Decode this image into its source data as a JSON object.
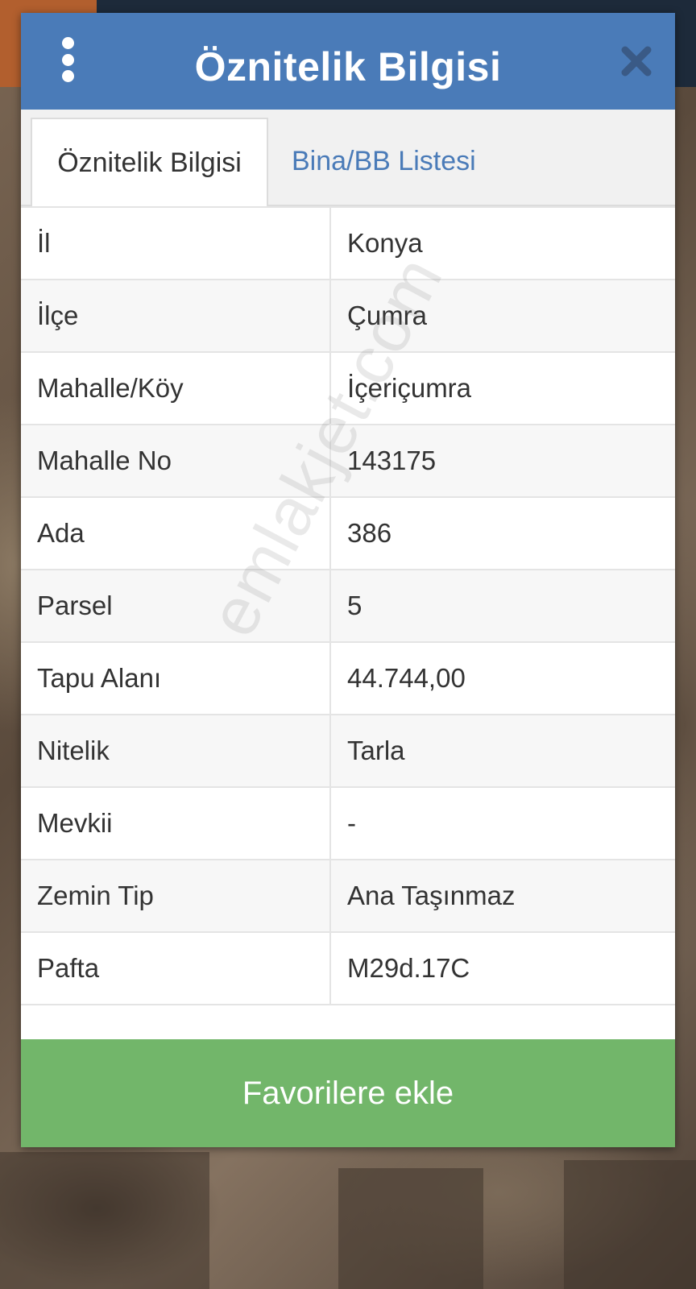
{
  "dialog": {
    "title": "Öznitelik Bilgisi",
    "header_color": "#4a7bb8"
  },
  "tabs": [
    {
      "label": "Öznitelik Bilgisi",
      "active": true
    },
    {
      "label": "Bina/BB Listesi",
      "active": false
    }
  ],
  "attributes": [
    {
      "key": "İl",
      "value": "Konya"
    },
    {
      "key": "İlçe",
      "value": "Çumra"
    },
    {
      "key": "Mahalle/Köy",
      "value": "İçeriçumra"
    },
    {
      "key": "Mahalle No",
      "value": "143175"
    },
    {
      "key": "Ada",
      "value": "386"
    },
    {
      "key": "Parsel",
      "value": "5"
    },
    {
      "key": "Tapu Alanı",
      "value": "44.744,00"
    },
    {
      "key": "Nitelik",
      "value": "Tarla"
    },
    {
      "key": "Mevkii",
      "value": "-"
    },
    {
      "key": "Zemin Tip",
      "value": "Ana Taşınmaz"
    },
    {
      "key": "Pafta",
      "value": "M29d.17C"
    }
  ],
  "favorite_button": {
    "label": "Favorilere ekle",
    "color": "#72b66a"
  },
  "watermark": {
    "text": "emlakjet.com"
  },
  "icons": {
    "menu": "vertical-dots-icon",
    "close": "close-icon"
  }
}
